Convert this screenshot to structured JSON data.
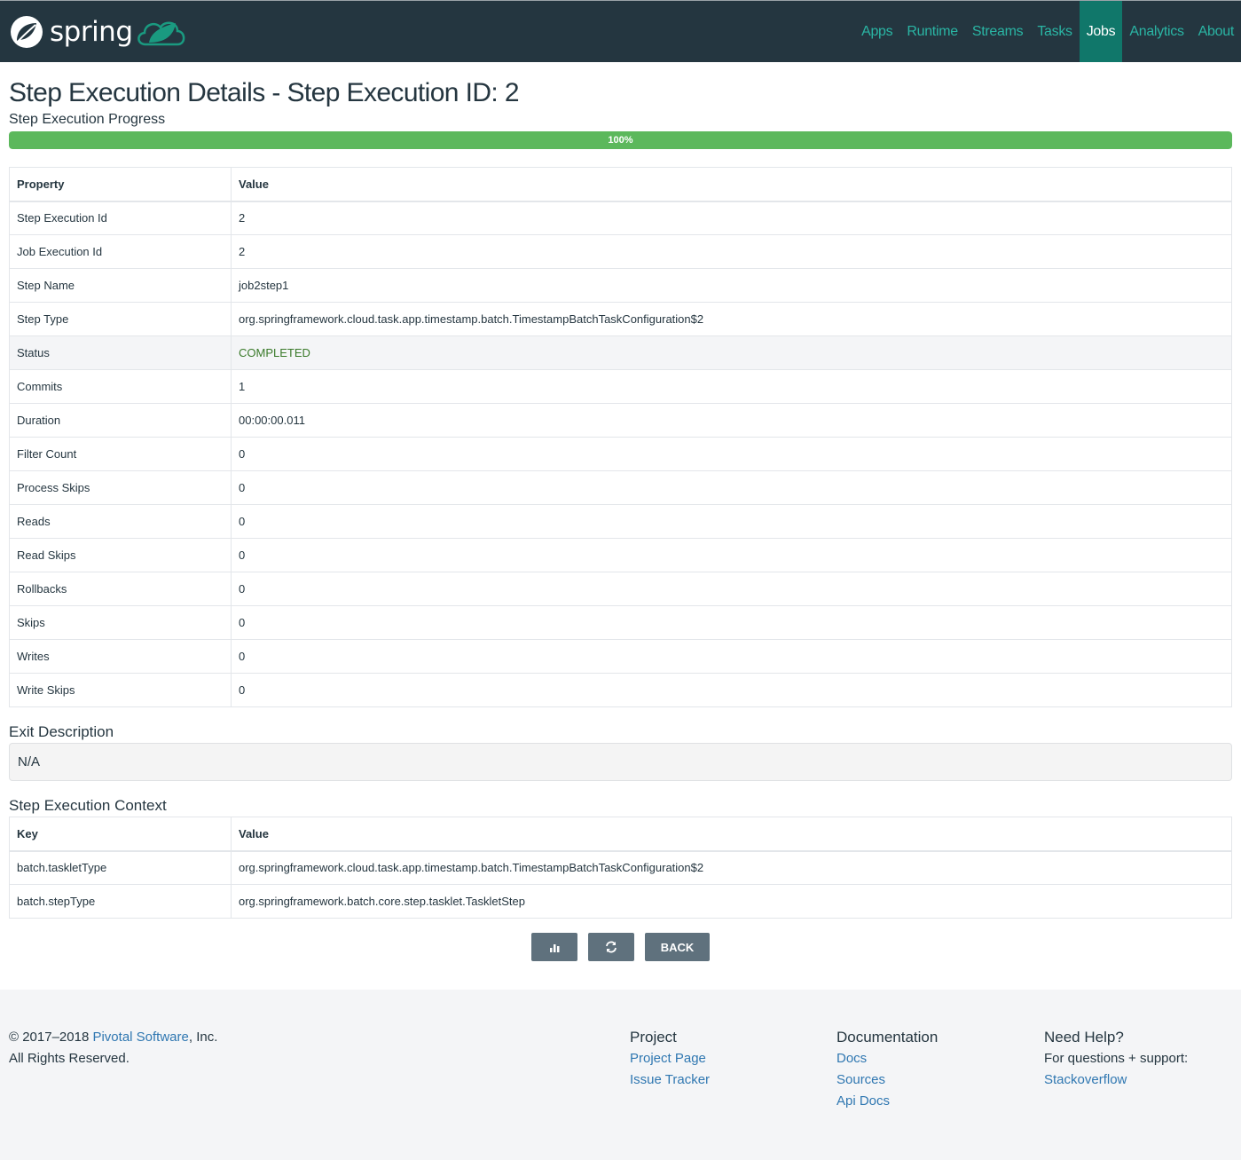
{
  "header": {
    "brand": "spring",
    "nav": [
      {
        "label": "Apps",
        "active": false
      },
      {
        "label": "Runtime",
        "active": false
      },
      {
        "label": "Streams",
        "active": false
      },
      {
        "label": "Tasks",
        "active": false
      },
      {
        "label": "Jobs",
        "active": true
      },
      {
        "label": "Analytics",
        "active": false
      },
      {
        "label": "About",
        "active": false
      }
    ]
  },
  "page": {
    "title": "Step Execution Details - Step Execution ID: 2",
    "progress_label": "Step Execution Progress",
    "progress_percent": 100,
    "progress_text": "100%"
  },
  "details_table": {
    "headers": [
      "Property",
      "Value"
    ],
    "rows": [
      {
        "property": "Step Execution Id",
        "value": "2"
      },
      {
        "property": "Job Execution Id",
        "value": "2"
      },
      {
        "property": "Step Name",
        "value": "job2step1"
      },
      {
        "property": "Step Type",
        "value": "org.springframework.cloud.task.app.timestamp.batch.TimestampBatchTaskConfiguration$2"
      },
      {
        "property": "Status",
        "value": "COMPLETED"
      },
      {
        "property": "Commits",
        "value": "1"
      },
      {
        "property": "Duration",
        "value": "00:00:00.011"
      },
      {
        "property": "Filter Count",
        "value": "0"
      },
      {
        "property": "Process Skips",
        "value": "0"
      },
      {
        "property": "Reads",
        "value": "0"
      },
      {
        "property": "Read Skips",
        "value": "0"
      },
      {
        "property": "Rollbacks",
        "value": "0"
      },
      {
        "property": "Skips",
        "value": "0"
      },
      {
        "property": "Writes",
        "value": "0"
      },
      {
        "property": "Write Skips",
        "value": "0"
      }
    ]
  },
  "exit_description": {
    "title": "Exit Description",
    "value": "N/A"
  },
  "context": {
    "title": "Step Execution Context",
    "headers": [
      "Key",
      "Value"
    ],
    "rows": [
      {
        "key": "batch.taskletType",
        "value": "org.springframework.cloud.task.app.timestamp.batch.TimestampBatchTaskConfiguration$2"
      },
      {
        "key": "batch.stepType",
        "value": "org.springframework.batch.core.step.tasklet.TaskletStep"
      }
    ]
  },
  "actions": {
    "chart_icon": "bar-chart-icon",
    "refresh_icon": "refresh-icon",
    "back_label": "BACK"
  },
  "footer": {
    "copyright_prefix": "© 2017–2018 ",
    "company_link": "Pivotal Software",
    "copyright_suffix": ", Inc.",
    "rights": "All Rights Reserved.",
    "project": {
      "heading": "Project",
      "links": [
        "Project Page",
        "Issue Tracker"
      ]
    },
    "documentation": {
      "heading": "Documentation",
      "links": [
        "Docs",
        "Sources",
        "Api Docs"
      ]
    },
    "help": {
      "heading": "Need Help?",
      "text": "For questions + support:",
      "links": [
        "Stackoverflow"
      ]
    }
  },
  "colors": {
    "navbar_bg": "#243640",
    "nav_link": "#2ab5a4",
    "nav_active_bg": "#10776a",
    "progress": "#5cb85c",
    "status_completed": "#3a7a2a",
    "button_bg": "#5f717d",
    "footer_link": "#2f77b1"
  }
}
